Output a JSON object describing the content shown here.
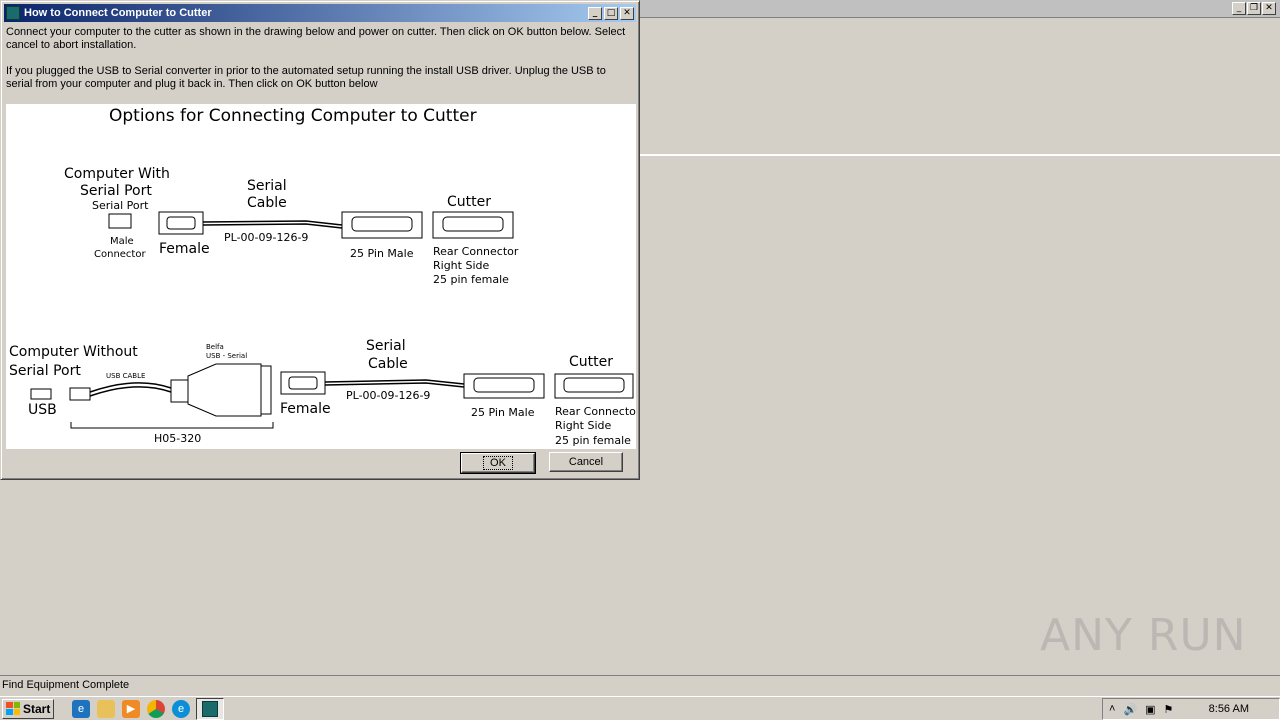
{
  "dialog": {
    "title": "How to Connect Computer to Cutter",
    "instructions": [
      "Connect your computer to the cutter as shown in the drawing below and power on cutter.  Then click on OK button below.  Select cancel to abort installation.",
      "If you plugged the USB to Serial converter in prior to the automated setup running the install USB  driver.  Unplug the USB to serial from your computer and plug it back in.   Then click on OK button below"
    ],
    "ok_label": "OK",
    "cancel_label": "Cancel",
    "drawing": {
      "heading": "Options for Connecting Computer to Cutter",
      "option1": {
        "computer_line1": "Computer With",
        "computer_line2": "Serial Port",
        "port_label": "Serial Port",
        "male_line1": "Male",
        "male_line2": "Connector",
        "female_label": "Female",
        "cable_line1": "Serial",
        "cable_line2": "Cable",
        "part_number": "PL-00-09-126-9",
        "male_25": "25 Pin Male",
        "cutter_label": "Cutter",
        "rear_line1": "Rear Connector",
        "rear_line2": "Right Side",
        "rear_line3": "25 pin female"
      },
      "option2": {
        "computer_line1": "Computer Without",
        "computer_line2": "Serial Port",
        "usb_label": "USB",
        "usb_cable": "USB CABLE",
        "belfa_line1": "Belfa",
        "belfa_line2": "USB - Serial",
        "adapter_part": "H05-320",
        "female_label": "Female",
        "cable_line1": "Serial",
        "cable_line2": "Cable",
        "part_number": "PL-00-09-126-9",
        "male_25": "25 Pin Male",
        "cutter_label": "Cutter",
        "rear_line1": "Rear Connector",
        "rear_line2": "Right Side",
        "rear_line3": "25 pin female"
      }
    }
  },
  "statusbar": {
    "text": "Find Equipment Complete"
  },
  "watermark": "ANY RUN",
  "taskbar": {
    "start_label": "Start",
    "clock": "8:56 AM"
  }
}
